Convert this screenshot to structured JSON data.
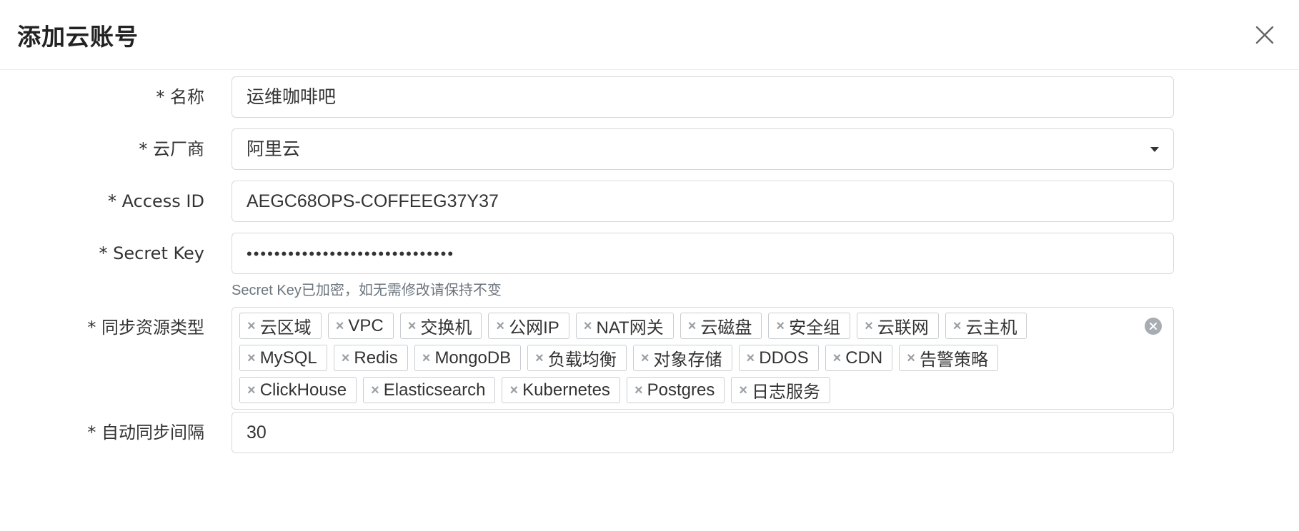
{
  "modal": {
    "title": "添加云账号",
    "close_icon": "close-icon"
  },
  "form": {
    "name": {
      "label": "* 名称",
      "value": "运维咖啡吧"
    },
    "provider": {
      "label": "* 云厂商",
      "value": "阿里云",
      "icon": "caret-down-icon"
    },
    "access_id": {
      "label": "* Access ID",
      "value": "AEGC68OPS-COFFEEG37Y37"
    },
    "secret_key": {
      "label": "* Secret Key",
      "value": "••••••••••••••••••••••••••••••",
      "hint": "Secret Key已加密，如无需修改请保持不变"
    },
    "resource_types": {
      "label": "* 同步资源类型",
      "tags": [
        "云区域",
        "VPC",
        "交换机",
        "公网IP",
        "NAT网关",
        "云磁盘",
        "安全组",
        "云联网",
        "云主机",
        "MySQL",
        "Redis",
        "MongoDB",
        "负载均衡",
        "对象存储",
        "DDOS",
        "CDN",
        "告警策略",
        "ClickHouse",
        "Elasticsearch",
        "Kubernetes",
        "Postgres",
        "日志服务"
      ],
      "tag_remove_glyph": "×",
      "clear_icon": "clear-all-icon"
    },
    "sync_interval": {
      "label": "* 自动同步间隔",
      "value": "30"
    }
  },
  "colors": {
    "border": "#d6d9dc",
    "hint": "#6c757d",
    "tag_x": "#9aa0a6"
  }
}
